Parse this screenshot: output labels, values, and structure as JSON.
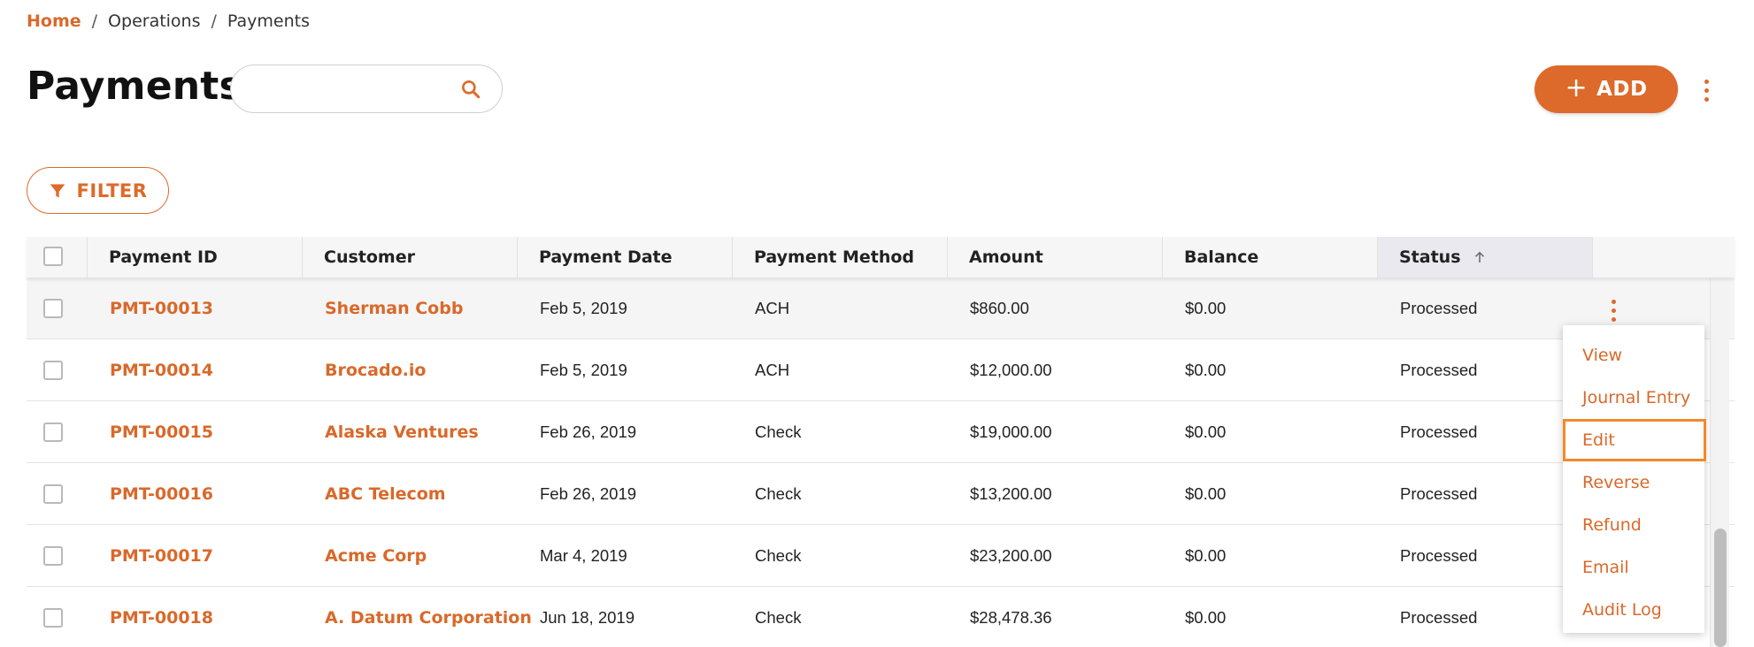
{
  "breadcrumb": {
    "home": "Home",
    "separator": "/",
    "items": [
      "Operations",
      "Payments"
    ]
  },
  "page": {
    "title": "Payments"
  },
  "search": {
    "value": "",
    "placeholder": ""
  },
  "toolbar": {
    "add_label": "ADD",
    "filter_label": "FILTER"
  },
  "table": {
    "columns": [
      "Payment ID",
      "Customer",
      "Payment Date",
      "Payment Method",
      "Amount",
      "Balance",
      "Status"
    ],
    "sorted_column": "Status",
    "sort_direction": "ascending",
    "rows": [
      {
        "id": "PMT-00013",
        "customer": "Sherman Cobb",
        "date": "Feb 5, 2019",
        "method": "ACH",
        "amount": "$860.00",
        "balance": "$0.00",
        "status": "Processed"
      },
      {
        "id": "PMT-00014",
        "customer": "Brocado.io",
        "date": "Feb 5, 2019",
        "method": "ACH",
        "amount": "$12,000.00",
        "balance": "$0.00",
        "status": "Processed"
      },
      {
        "id": "PMT-00015",
        "customer": "Alaska Ventures",
        "date": "Feb 26, 2019",
        "method": "Check",
        "amount": "$19,000.00",
        "balance": "$0.00",
        "status": "Processed"
      },
      {
        "id": "PMT-00016",
        "customer": "ABC Telecom",
        "date": "Feb 26, 2019",
        "method": "Check",
        "amount": "$13,200.00",
        "balance": "$0.00",
        "status": "Processed"
      },
      {
        "id": "PMT-00017",
        "customer": "Acme Corp",
        "date": "Mar 4, 2019",
        "method": "Check",
        "amount": "$23,200.00",
        "balance": "$0.00",
        "status": "Processed"
      },
      {
        "id": "PMT-00018",
        "customer": "A. Datum Corporation",
        "date": "Jun 18, 2019",
        "method": "Check",
        "amount": "$28,478.36",
        "balance": "$0.00",
        "status": "Processed"
      }
    ]
  },
  "row_menu": {
    "items": [
      "View",
      "Journal Entry",
      "Edit",
      "Reverse",
      "Refund",
      "Email",
      "Audit Log"
    ],
    "focused": "Edit"
  },
  "colors": {
    "accent": "#dd6a2a",
    "focus_outline": "#f08a2b",
    "header_bg": "#f6f6f6",
    "sorted_header_bg": "#e9e9ef"
  }
}
